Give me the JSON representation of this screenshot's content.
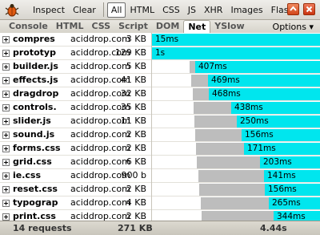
{
  "toolbar": {
    "inspect_label": "Inspect",
    "clear_label": "Clear",
    "filters": [
      "All",
      "HTML",
      "CSS",
      "JS",
      "XHR",
      "Images",
      "Flash"
    ],
    "selected_filter": "All"
  },
  "tabs": {
    "items": [
      "Console",
      "HTML",
      "CSS",
      "Script",
      "DOM",
      "Net",
      "YSlow"
    ],
    "selected": "Net",
    "options_label": "Options ▾"
  },
  "requests": [
    {
      "name": "compres",
      "domain": "aciddrop.com",
      "size": "3 KB",
      "time": "15ms",
      "start": 0.0,
      "wait": 0.0,
      "end": 1.0
    },
    {
      "name": "prototyp",
      "domain": "aciddrop.com",
      "size": "129 KB",
      "time": "1s",
      "start": 0.0,
      "wait": 0.0,
      "end": 1.0
    },
    {
      "name": "builder.js",
      "domain": "aciddrop.com",
      "size": "5 KB",
      "time": "407ms",
      "start": 0.225,
      "wait": 0.255,
      "end": 1.0
    },
    {
      "name": "effects.js",
      "domain": "aciddrop.com",
      "size": "41 KB",
      "time": "469ms",
      "start": 0.23,
      "wait": 0.33,
      "end": 1.0
    },
    {
      "name": "dragdrop",
      "domain": "aciddrop.com",
      "size": "32 KB",
      "time": "468ms",
      "start": 0.24,
      "wait": 0.335,
      "end": 1.0
    },
    {
      "name": "controls.",
      "domain": "aciddrop.com",
      "size": "35 KB",
      "time": "438ms",
      "start": 0.245,
      "wait": 0.47,
      "end": 1.0
    },
    {
      "name": "slider.js",
      "domain": "aciddrop.com",
      "size": "11 KB",
      "time": "250ms",
      "start": 0.25,
      "wait": 0.5,
      "end": 1.0
    },
    {
      "name": "sound.js",
      "domain": "aciddrop.com",
      "size": "2 KB",
      "time": "156ms",
      "start": 0.255,
      "wait": 0.53,
      "end": 1.0
    },
    {
      "name": "forms.css",
      "domain": "aciddrop.com",
      "size": "2 KB",
      "time": "171ms",
      "start": 0.26,
      "wait": 0.545,
      "end": 1.0
    },
    {
      "name": "grid.css",
      "domain": "aciddrop.com",
      "size": "6 KB",
      "time": "203ms",
      "start": 0.265,
      "wait": 0.64,
      "end": 1.0
    },
    {
      "name": "ie.css",
      "domain": "aciddrop.com",
      "size": "900 b",
      "time": "141ms",
      "start": 0.275,
      "wait": 0.665,
      "end": 1.0
    },
    {
      "name": "reset.css",
      "domain": "aciddrop.com",
      "size": "2 KB",
      "time": "156ms",
      "start": 0.28,
      "wait": 0.67,
      "end": 1.0
    },
    {
      "name": "typograp",
      "domain": "aciddrop.com",
      "size": "4 KB",
      "time": "265ms",
      "start": 0.29,
      "wait": 0.69,
      "end": 1.0
    },
    {
      "name": "print.css",
      "domain": "aciddrop.com",
      "size": "2 KB",
      "time": "344ms",
      "start": 0.295,
      "wait": 0.72,
      "end": 1.0
    }
  ],
  "footer": {
    "requests_label": "14 requests",
    "total_size": "271 KB",
    "total_time": "4.44s"
  },
  "colors": {
    "bar_load": "#00e6ee",
    "bar_wait": "#bdbdbd"
  },
  "icons": {
    "firebug": "firebug-icon",
    "up": "up-arrow-icon",
    "close": "close-icon",
    "expander": "plus-expander-icon"
  }
}
